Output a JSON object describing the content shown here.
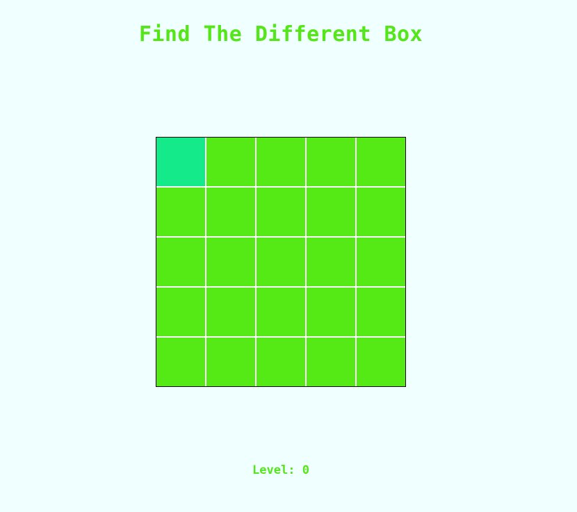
{
  "title": "Find The Different Box",
  "colors": {
    "background": "#f0ffff",
    "text": "#55e619",
    "tile": "#55ea15",
    "odd_tile": "#15ea8a",
    "gridline": "#ffffff",
    "border": "#000000"
  },
  "grid": {
    "rows": 5,
    "cols": 5,
    "odd_tile": {
      "row": 0,
      "col": 0
    }
  },
  "level": {
    "label": "Level: ",
    "value": "0"
  }
}
